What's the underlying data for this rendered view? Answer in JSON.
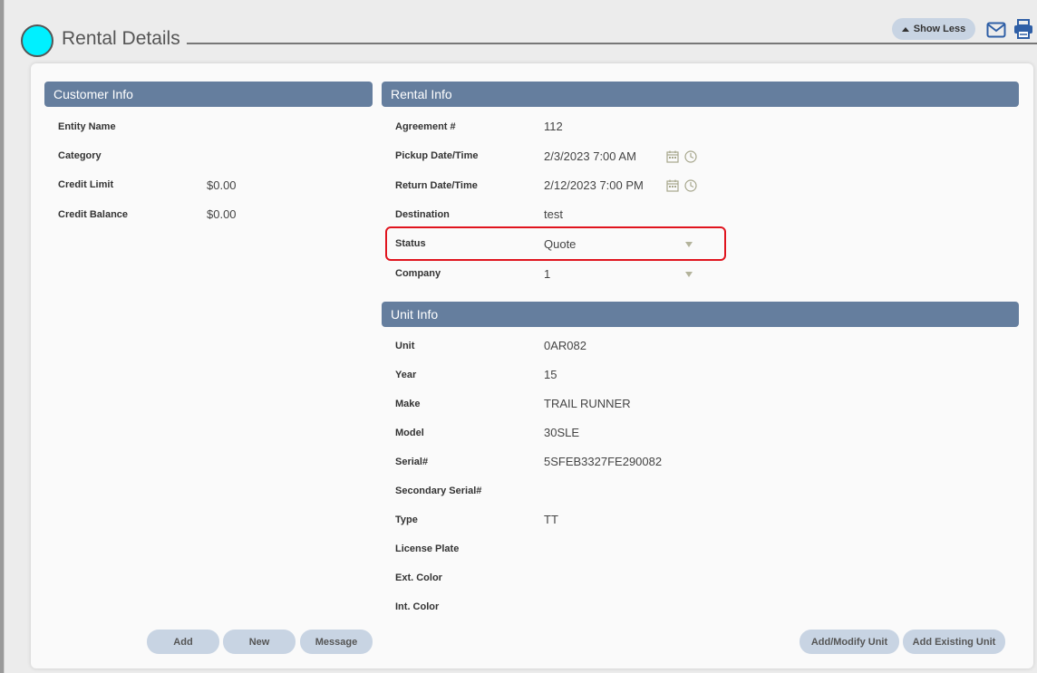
{
  "header": {
    "title": "Rental Details",
    "show_less_label": "Show Less"
  },
  "customer_info": {
    "title": "Customer Info",
    "fields": [
      {
        "label": "Entity Name",
        "value": ""
      },
      {
        "label": "Category",
        "value": ""
      },
      {
        "label": "Credit Limit",
        "value": "$0.00"
      },
      {
        "label": "Credit Balance",
        "value": "$0.00"
      }
    ]
  },
  "rental_info": {
    "title": "Rental Info",
    "agreement_label": "Agreement #",
    "agreement_value": "112",
    "pickup_label": "Pickup Date/Time",
    "pickup_value": "2/3/2023 7:00 AM",
    "return_label": "Return Date/Time",
    "return_value": "2/12/2023 7:00 PM",
    "destination_label": "Destination",
    "destination_value": "test",
    "status_label": "Status",
    "status_value": "Quote",
    "company_label": "Company",
    "company_value": "1"
  },
  "unit_info": {
    "title": "Unit Info",
    "fields": [
      {
        "label": "Unit",
        "value": "0AR082"
      },
      {
        "label": "Year",
        "value": "15"
      },
      {
        "label": "Make",
        "value": "TRAIL RUNNER"
      },
      {
        "label": "Model",
        "value": "30SLE"
      },
      {
        "label": "Serial#",
        "value": "5SFEB3327FE290082"
      },
      {
        "label": "Secondary Serial#",
        "value": ""
      },
      {
        "label": "Type",
        "value": "TT"
      },
      {
        "label": "License Plate",
        "value": ""
      },
      {
        "label": "Ext. Color",
        "value": ""
      },
      {
        "label": "Int. Color",
        "value": ""
      }
    ]
  },
  "buttons": {
    "add": "Add",
    "new": "New",
    "message": "Message",
    "add_modify_unit": "Add/Modify Unit",
    "add_existing_unit": "Add Existing Unit"
  },
  "colors": {
    "section_bar": "#657e9e",
    "button_bg": "#c8d4e3",
    "status_circle": "#00f0ff",
    "highlight": "#e0141e"
  }
}
